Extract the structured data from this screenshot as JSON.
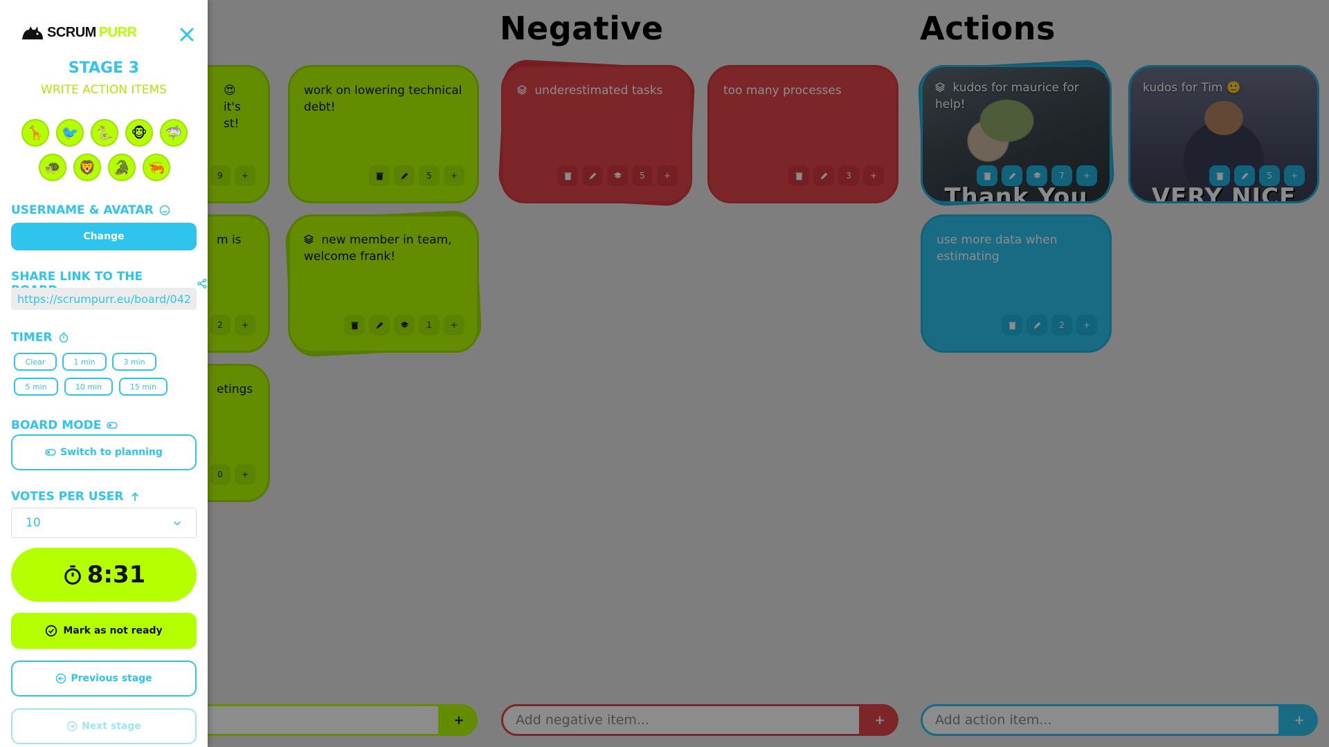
{
  "brand": {
    "scrum": "SCRUM",
    "purr": "PURR"
  },
  "sidebar": {
    "stage_title": "STAGE 3",
    "stage_subtitle": "WRITE ACTION ITEMS",
    "avatars": [
      "giraffe-avatar",
      "bird-avatar",
      "snake-avatar",
      "monkey-avatar",
      "shark-avatar",
      "turtle-avatar",
      "lion-avatar",
      "crocodile-avatar",
      "shrimp-avatar"
    ],
    "username_label": "USERNAME & AVATAR",
    "change_label": "Change",
    "share_label": "SHARE LINK TO THE BOARD",
    "share_url": "https://scrumpurr.eu/board/042",
    "timer_label": "TIMER",
    "timer_buttons": [
      "Clear",
      "1 min",
      "3 min",
      "5 min",
      "10 min",
      "15 min"
    ],
    "board_mode_label": "BOARD MODE",
    "switch_label": "Switch to planning",
    "votes_label": "VOTES PER USER",
    "votes_value": "10",
    "countdown": "8:31",
    "ready_label": "Mark as not ready",
    "prev_label": "Previous stage",
    "next_label": "Next stage"
  },
  "board": {
    "columns": {
      "negative": "Negative",
      "actions": "Actions"
    },
    "positive_cards": [
      {
        "text": "it's st!",
        "votes": "9"
      },
      {
        "text": "work on lowering technical debt!",
        "votes": "5"
      },
      {
        "text": "m is",
        "votes": "2"
      },
      {
        "text": "new member in team, welcome frank!",
        "votes": "1"
      },
      {
        "text": "etings",
        "votes": "0"
      }
    ],
    "negative_cards": [
      {
        "text": "underestimated tasks",
        "votes": "5"
      },
      {
        "text": "too many processes",
        "votes": "3"
      }
    ],
    "action_cards": [
      {
        "text": "kudos for maurice for help!",
        "votes": "7",
        "meme": "Thank You"
      },
      {
        "text": "kudos for Tim",
        "votes": "5",
        "meme": "VERY NICE"
      },
      {
        "text": "use more data when estimating",
        "votes": "2"
      }
    ],
    "add_negative_placeholder": "Add negative item...",
    "add_action_placeholder": "Add action item...",
    "add_button": "+"
  },
  "colors": {
    "green": "#b4ff00",
    "red": "#e4464c",
    "blue": "#2fc4ee"
  }
}
